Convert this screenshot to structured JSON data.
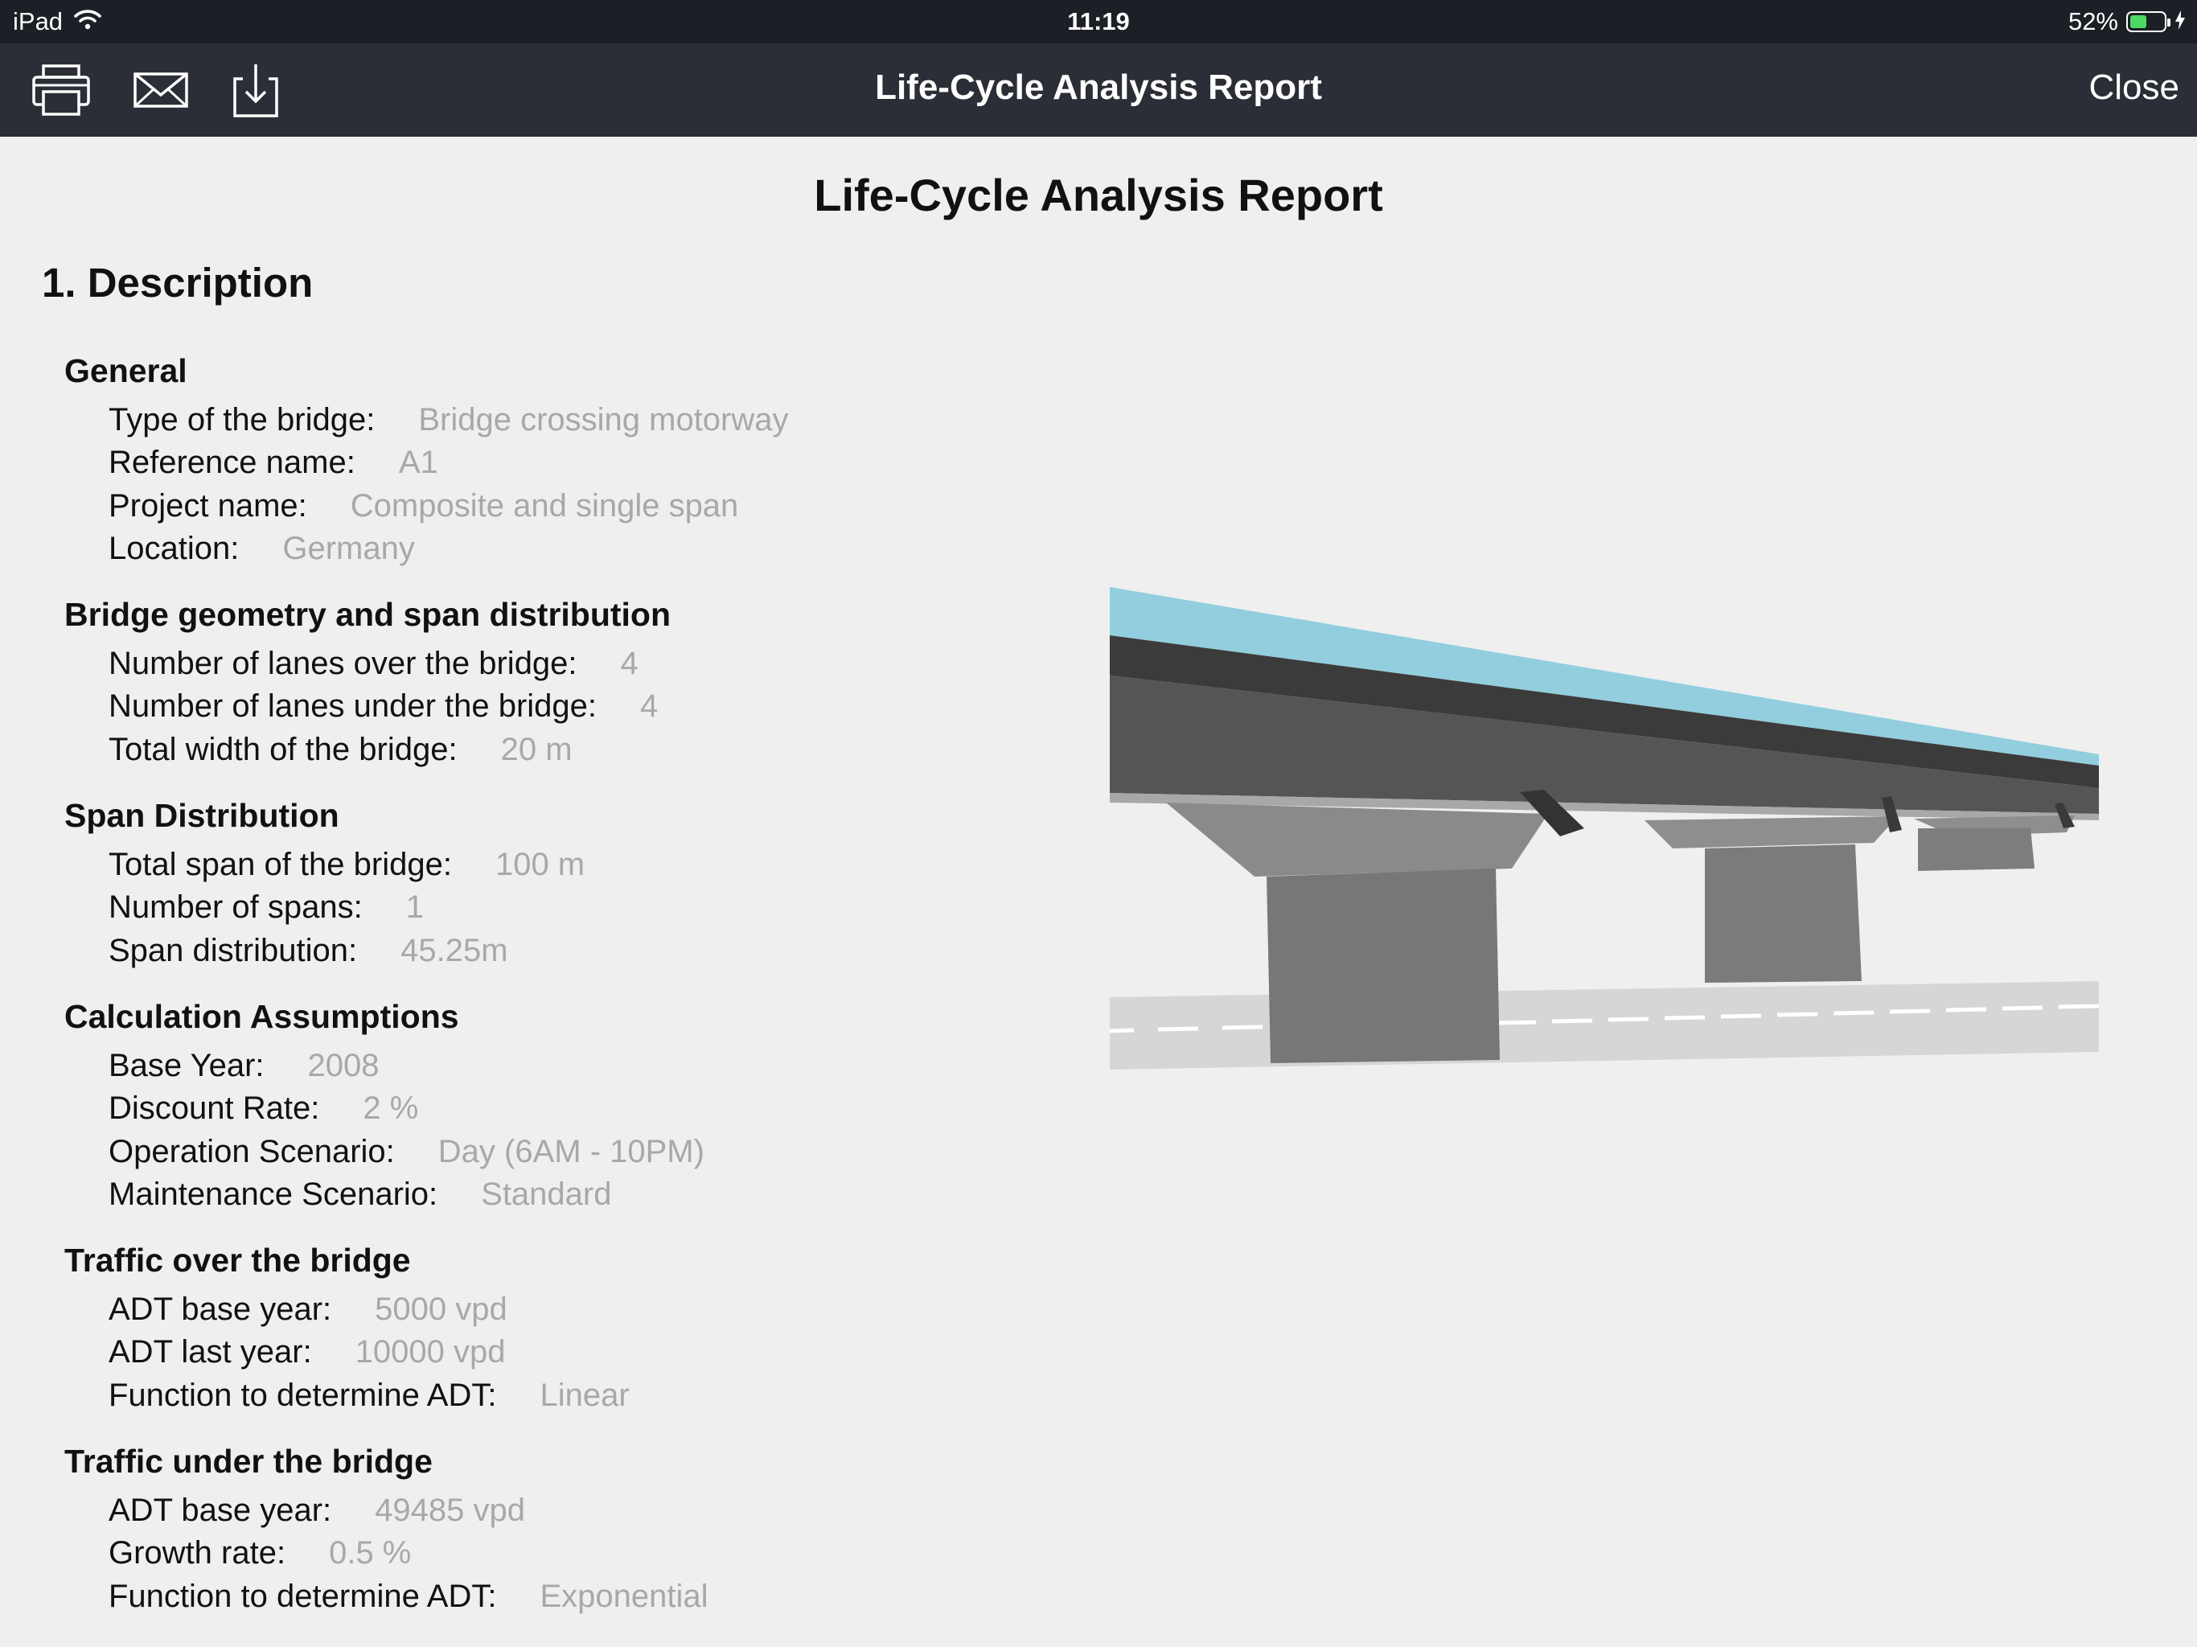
{
  "status_bar": {
    "device": "iPad",
    "time": "11:19",
    "battery": "52%",
    "battery_level": 0.52
  },
  "nav_bar": {
    "title": "Life-Cycle Analysis Report",
    "close_label": "Close",
    "icons": [
      "print-icon",
      "mail-icon",
      "download-icon"
    ]
  },
  "report": {
    "title": "Life-Cycle Analysis Report",
    "section": "1. Description",
    "subsections": [
      {
        "title": "General",
        "fields": [
          {
            "label": "Type of the bridge:",
            "value": "Bridge crossing motorway"
          },
          {
            "label": "Reference name:",
            "value": "A1"
          },
          {
            "label": "Project name:",
            "value": "Composite and single span"
          },
          {
            "label": "Location:",
            "value": "Germany"
          }
        ]
      },
      {
        "title": "Bridge geometry and span distribution",
        "fields": [
          {
            "label": "Number of lanes over the bridge:",
            "value": "4"
          },
          {
            "label": "Number of lanes under the bridge:",
            "value": "4"
          },
          {
            "label": "Total width of the bridge:",
            "value": "20 m"
          }
        ]
      },
      {
        "title": "Span Distribution",
        "fields": [
          {
            "label": "Total span of the bridge:",
            "value": "100 m"
          },
          {
            "label": "Number of spans:",
            "value": "1"
          },
          {
            "label": "Span distribution:",
            "value": "45.25m"
          }
        ]
      },
      {
        "title": "Calculation Assumptions",
        "fields": [
          {
            "label": "Base Year:",
            "value": "2008"
          },
          {
            "label": "Discount Rate:",
            "value": "2 %"
          },
          {
            "label": "Operation Scenario:",
            "value": "Day (6AM - 10PM)"
          },
          {
            "label": "Maintenance Scenario:",
            "value": "Standard"
          }
        ]
      },
      {
        "title": "Traffic over the bridge",
        "fields": [
          {
            "label": "ADT base year:",
            "value": "5000 vpd"
          },
          {
            "label": "ADT last year:",
            "value": "10000 vpd"
          },
          {
            "label": "Function to determine ADT:",
            "value": "Linear"
          }
        ]
      },
      {
        "title": "Traffic under the bridge",
        "fields": [
          {
            "label": "ADT base year:",
            "value": "49485 vpd"
          },
          {
            "label": "Growth rate:",
            "value": "0.5 %"
          },
          {
            "label": "Function to determine ADT:",
            "value": "Exponential"
          }
        ]
      }
    ]
  },
  "colors": {
    "status_bar_bg": "#1c1f26",
    "nav_bar_bg": "#2b2e36",
    "page_bg": "#efefef",
    "value_text": "#a8a8a8",
    "bridge_deck_top": "#90cfdd",
    "battery_fill": "#4cd964"
  }
}
